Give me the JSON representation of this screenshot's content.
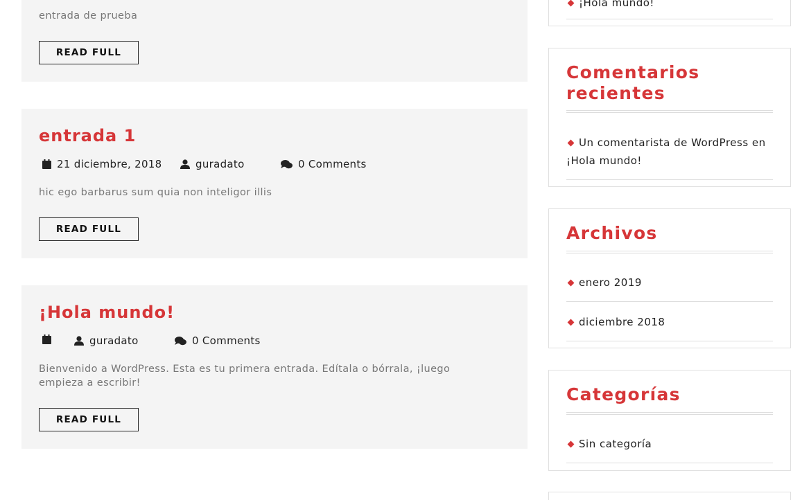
{
  "colors": {
    "accent": "#d63638",
    "post_bg": "#f4f4f4",
    "text": "#222222",
    "muted": "#777777"
  },
  "posts": [
    {
      "excerpt": "entrada de prueba",
      "button": "READ FULL"
    },
    {
      "title": "entrada 1",
      "date": "21 diciembre, 2018",
      "author": "guradato",
      "comments": "0 Comments",
      "excerpt": "hic ego barbarus sum quia non inteligor illis",
      "button": "READ FULL"
    },
    {
      "title": "¡Hola mundo!",
      "date": "",
      "author": "guradato",
      "comments": "0 Comments",
      "excerpt": "Bienvenido a WordPress. Esta es tu primera entrada. Edítala o bórrala, ¡luego empieza a escribir!",
      "button": "READ FULL"
    }
  ],
  "sidebar": {
    "top_item": "¡Hola mundo!",
    "recent_comments": {
      "title": "Comentarios recientes",
      "author": "Un comentarista de WordPress",
      "connector": "en",
      "post": "¡Hola mundo!"
    },
    "archives": {
      "title": "Archivos",
      "items": [
        "enero 2019",
        "diciembre 2018"
      ]
    },
    "categories": {
      "title": "Categorías",
      "items": [
        "Sin categoría"
      ]
    }
  }
}
